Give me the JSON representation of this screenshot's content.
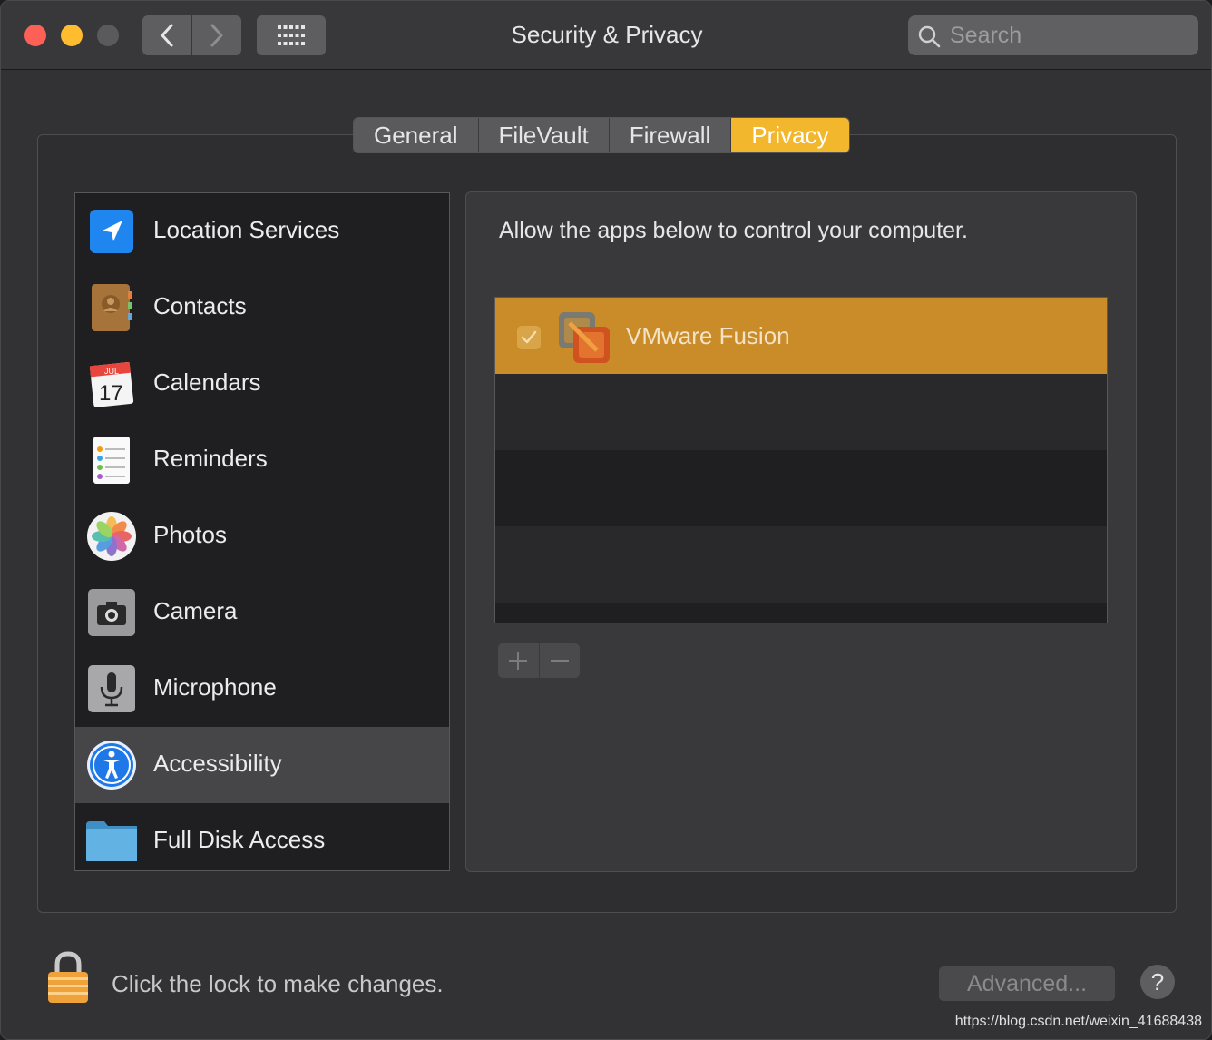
{
  "window": {
    "title": "Security & Privacy"
  },
  "search": {
    "placeholder": "Search"
  },
  "tabs": [
    {
      "label": "General",
      "active": false
    },
    {
      "label": "FileVault",
      "active": false
    },
    {
      "label": "Firewall",
      "active": false
    },
    {
      "label": "Privacy",
      "active": true
    }
  ],
  "sidebar": {
    "items": [
      {
        "label": "Location Services",
        "icon": "location-arrow-icon"
      },
      {
        "label": "Contacts",
        "icon": "contacts-book-icon"
      },
      {
        "label": "Calendars",
        "icon": "calendar-icon",
        "month": "JUL",
        "day": "17"
      },
      {
        "label": "Reminders",
        "icon": "reminders-icon"
      },
      {
        "label": "Photos",
        "icon": "photos-flower-icon"
      },
      {
        "label": "Camera",
        "icon": "camera-icon"
      },
      {
        "label": "Microphone",
        "icon": "microphone-icon"
      },
      {
        "label": "Accessibility",
        "icon": "accessibility-icon",
        "selected": true
      },
      {
        "label": "Full Disk Access",
        "icon": "folder-icon"
      }
    ]
  },
  "main": {
    "description": "Allow the apps below to control your computer.",
    "apps": [
      {
        "name": "VMware Fusion",
        "checked": true,
        "icon": "vmware-fusion-icon"
      }
    ]
  },
  "footer": {
    "lock_text": "Click the lock to make changes.",
    "advanced_label": "Advanced...",
    "help_label": "?"
  },
  "watermark": "https://blog.csdn.net/weixin_41688438",
  "colors": {
    "accent": "#f2b72c",
    "selected_row": "#c98c28",
    "background": "#323234"
  }
}
